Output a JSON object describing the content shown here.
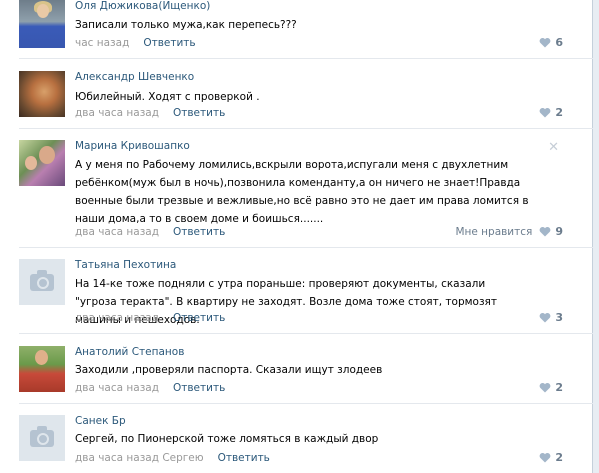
{
  "comments": [
    {
      "author": "Оля Дюжикова(Ищенко)",
      "text": "Записали только мужа,как перепесь???",
      "time": "час назад",
      "reply_label": "Ответить",
      "likes": "6",
      "likes_label": ""
    },
    {
      "author": "Александр Шевченко",
      "text": "Юбилейный. Ходят с проверкой .",
      "time": "два часа назад",
      "reply_label": "Ответить",
      "likes": "2",
      "likes_label": ""
    },
    {
      "author": "Марина Кривошапко",
      "text": "А у меня по Рабочему ломились,вскрыли ворота,испугали меня с двухлетним ребёнком(муж был в ночь),позвонила коменданту,а он ничего не знает!Правда военные были трезвые и вежливые,но всё равно это не дает им права ломится в наши дома,а то в своем доме и боишься.......",
      "time": "два часа назад",
      "reply_label": "Ответить",
      "likes": "9",
      "likes_label": "Мне нравится"
    },
    {
      "author": "Татьяна Пехотина",
      "text": "На 14-ке тоже подняли с утра пораньше: проверяют документы, сказали \"угроза теракта\". В квартиру не заходят. Возле дома тоже стоят, тормозят машины и пешеходов.",
      "time": "два часа назад",
      "reply_label": "Ответить",
      "likes": "3",
      "likes_label": ""
    },
    {
      "author": "Анатолий Степанов",
      "text": "Заходили ,проверяли паспорта. Сказали ищут злодеев",
      "time": "два часа назад",
      "reply_label": "Ответить",
      "likes": "2",
      "likes_label": ""
    },
    {
      "author": "Санек Бр",
      "text": "Сергей, по Пионерской тоже ломяться в каждый двор",
      "time": "два часа назад Сергею",
      "reply_label": "Ответить",
      "likes": "2",
      "likes_label": ""
    }
  ],
  "icons": {
    "like": "heart-icon",
    "remove": "close-icon",
    "no_photo": "camera-icon"
  },
  "colors": {
    "link": "#2b587a",
    "meta": "#999999",
    "heart": "#a3b6c9",
    "divider": "#e4e8ed"
  }
}
